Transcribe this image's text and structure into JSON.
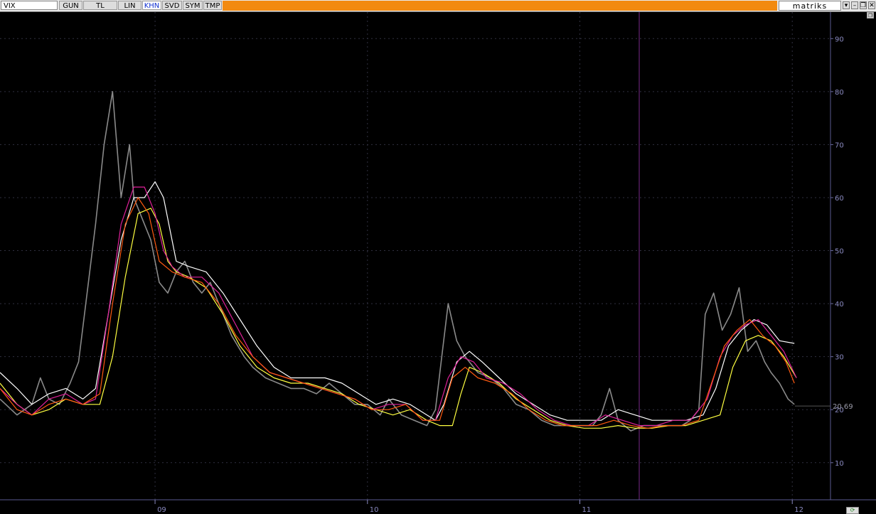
{
  "toolbar": {
    "symbol": "VIX",
    "tabs": [
      {
        "label": "GUN",
        "active": false
      },
      {
        "label": "TL",
        "active": false
      },
      {
        "label": "LIN",
        "active": false
      },
      {
        "label": "KHN",
        "active": true
      },
      {
        "label": "SVD",
        "active": false
      },
      {
        "label": "SYM",
        "active": false
      },
      {
        "label": "TMP",
        "active": false
      }
    ],
    "brand": "matriks",
    "accent_color": "#f28a10"
  },
  "chart_data": {
    "type": "line",
    "ylim": [
      3,
      95
    ],
    "y_ticks": [
      10,
      20,
      30,
      40,
      50,
      60,
      70,
      80,
      90
    ],
    "x_ticks": [
      {
        "label": "09",
        "x": 2009.0
      },
      {
        "label": "10",
        "x": 2010.0
      },
      {
        "label": "11",
        "x": 2011.0
      },
      {
        "label": "12",
        "x": 2012.0
      }
    ],
    "xlim": [
      2008.27,
      2012.18
    ],
    "last_value": "20.69",
    "last_value_num": 20.69,
    "grid": true,
    "series": [
      {
        "key": "price",
        "color": "#8a8a8a",
        "points": [
          [
            2008.27,
            22
          ],
          [
            2008.35,
            19
          ],
          [
            2008.42,
            21
          ],
          [
            2008.46,
            26
          ],
          [
            2008.5,
            22
          ],
          [
            2008.55,
            21
          ],
          [
            2008.6,
            25
          ],
          [
            2008.64,
            29
          ],
          [
            2008.68,
            42
          ],
          [
            2008.72,
            55
          ],
          [
            2008.76,
            70
          ],
          [
            2008.8,
            80
          ],
          [
            2008.84,
            60
          ],
          [
            2008.88,
            70
          ],
          [
            2008.9,
            60
          ],
          [
            2008.94,
            56
          ],
          [
            2008.98,
            52
          ],
          [
            2009.02,
            44
          ],
          [
            2009.06,
            42
          ],
          [
            2009.1,
            46
          ],
          [
            2009.14,
            48
          ],
          [
            2009.18,
            44
          ],
          [
            2009.22,
            42
          ],
          [
            2009.26,
            44
          ],
          [
            2009.32,
            38
          ],
          [
            2009.36,
            34
          ],
          [
            2009.42,
            30
          ],
          [
            2009.46,
            28
          ],
          [
            2009.52,
            26
          ],
          [
            2009.58,
            25
          ],
          [
            2009.64,
            24
          ],
          [
            2009.7,
            24
          ],
          [
            2009.76,
            23
          ],
          [
            2009.82,
            25
          ],
          [
            2009.88,
            23
          ],
          [
            2009.94,
            21
          ],
          [
            2010.0,
            21
          ],
          [
            2010.06,
            19
          ],
          [
            2010.1,
            22
          ],
          [
            2010.16,
            19
          ],
          [
            2010.22,
            18
          ],
          [
            2010.28,
            17
          ],
          [
            2010.32,
            20
          ],
          [
            2010.35,
            30
          ],
          [
            2010.38,
            40
          ],
          [
            2010.42,
            33
          ],
          [
            2010.46,
            30
          ],
          [
            2010.52,
            27
          ],
          [
            2010.58,
            26
          ],
          [
            2010.64,
            24
          ],
          [
            2010.7,
            21
          ],
          [
            2010.76,
            20
          ],
          [
            2010.82,
            18
          ],
          [
            2010.88,
            17
          ],
          [
            2010.94,
            17
          ],
          [
            2011.0,
            17
          ],
          [
            2011.06,
            17
          ],
          [
            2011.1,
            19
          ],
          [
            2011.14,
            24
          ],
          [
            2011.18,
            18
          ],
          [
            2011.24,
            16
          ],
          [
            2011.3,
            17
          ],
          [
            2011.36,
            17
          ],
          [
            2011.42,
            17
          ],
          [
            2011.48,
            17
          ],
          [
            2011.52,
            18
          ],
          [
            2011.56,
            20
          ],
          [
            2011.59,
            38
          ],
          [
            2011.63,
            42
          ],
          [
            2011.67,
            35
          ],
          [
            2011.71,
            38
          ],
          [
            2011.75,
            43
          ],
          [
            2011.79,
            31
          ],
          [
            2011.83,
            33
          ],
          [
            2011.87,
            29
          ],
          [
            2011.9,
            27
          ],
          [
            2011.94,
            25
          ],
          [
            2011.98,
            22
          ],
          [
            2012.01,
            21
          ]
        ]
      },
      {
        "key": "ma_white",
        "color": "#ffffff",
        "points": [
          [
            2008.27,
            27
          ],
          [
            2008.35,
            24
          ],
          [
            2008.42,
            21
          ],
          [
            2008.5,
            23
          ],
          [
            2008.58,
            24
          ],
          [
            2008.66,
            22
          ],
          [
            2008.72,
            24
          ],
          [
            2008.78,
            38
          ],
          [
            2008.84,
            52
          ],
          [
            2008.9,
            60
          ],
          [
            2008.95,
            60
          ],
          [
            2009.0,
            63
          ],
          [
            2009.04,
            60
          ],
          [
            2009.1,
            48
          ],
          [
            2009.16,
            47
          ],
          [
            2009.24,
            46
          ],
          [
            2009.32,
            42
          ],
          [
            2009.4,
            37
          ],
          [
            2009.48,
            32
          ],
          [
            2009.56,
            28
          ],
          [
            2009.64,
            26
          ],
          [
            2009.72,
            26
          ],
          [
            2009.8,
            26
          ],
          [
            2009.88,
            25
          ],
          [
            2009.96,
            23
          ],
          [
            2010.04,
            21
          ],
          [
            2010.12,
            22
          ],
          [
            2010.2,
            21
          ],
          [
            2010.28,
            19
          ],
          [
            2010.32,
            18
          ],
          [
            2010.36,
            21
          ],
          [
            2010.42,
            29
          ],
          [
            2010.48,
            31
          ],
          [
            2010.54,
            29
          ],
          [
            2010.62,
            26
          ],
          [
            2010.7,
            23
          ],
          [
            2010.78,
            21
          ],
          [
            2010.86,
            19
          ],
          [
            2010.94,
            18
          ],
          [
            2011.02,
            18
          ],
          [
            2011.1,
            18
          ],
          [
            2011.18,
            20
          ],
          [
            2011.26,
            19
          ],
          [
            2011.34,
            18
          ],
          [
            2011.42,
            18
          ],
          [
            2011.5,
            18
          ],
          [
            2011.58,
            19
          ],
          [
            2011.64,
            24
          ],
          [
            2011.7,
            32
          ],
          [
            2011.76,
            35
          ],
          [
            2011.82,
            37
          ],
          [
            2011.88,
            36
          ],
          [
            2011.94,
            33
          ],
          [
            2012.01,
            32.5
          ]
        ]
      },
      {
        "key": "ma_yellow",
        "color": "#ffff40",
        "points": [
          [
            2008.27,
            25
          ],
          [
            2008.35,
            21
          ],
          [
            2008.42,
            19
          ],
          [
            2008.5,
            20
          ],
          [
            2008.58,
            22
          ],
          [
            2008.66,
            21
          ],
          [
            2008.74,
            21
          ],
          [
            2008.8,
            30
          ],
          [
            2008.86,
            45
          ],
          [
            2008.92,
            57
          ],
          [
            2008.98,
            58
          ],
          [
            2009.02,
            55
          ],
          [
            2009.06,
            48
          ],
          [
            2009.1,
            46
          ],
          [
            2009.16,
            45
          ],
          [
            2009.24,
            43
          ],
          [
            2009.32,
            38
          ],
          [
            2009.4,
            32
          ],
          [
            2009.48,
            28
          ],
          [
            2009.56,
            26
          ],
          [
            2009.64,
            25
          ],
          [
            2009.72,
            25
          ],
          [
            2009.8,
            24
          ],
          [
            2009.88,
            23
          ],
          [
            2009.96,
            21
          ],
          [
            2010.04,
            20
          ],
          [
            2010.12,
            19
          ],
          [
            2010.2,
            20
          ],
          [
            2010.28,
            18
          ],
          [
            2010.34,
            17
          ],
          [
            2010.4,
            17
          ],
          [
            2010.44,
            23
          ],
          [
            2010.48,
            28
          ],
          [
            2010.54,
            27
          ],
          [
            2010.62,
            25
          ],
          [
            2010.7,
            22
          ],
          [
            2010.78,
            20
          ],
          [
            2010.86,
            18
          ],
          [
            2010.94,
            17
          ],
          [
            2011.02,
            16.5
          ],
          [
            2011.1,
            16.5
          ],
          [
            2011.18,
            17
          ],
          [
            2011.26,
            16.5
          ],
          [
            2011.34,
            16.5
          ],
          [
            2011.42,
            17
          ],
          [
            2011.5,
            17
          ],
          [
            2011.58,
            18
          ],
          [
            2011.66,
            19
          ],
          [
            2011.72,
            28
          ],
          [
            2011.78,
            33
          ],
          [
            2011.84,
            34
          ],
          [
            2011.9,
            33
          ],
          [
            2011.96,
            30
          ],
          [
            2012.02,
            26
          ]
        ]
      },
      {
        "key": "ma_magenta",
        "color": "#e0209a",
        "points": [
          [
            2008.27,
            24
          ],
          [
            2008.35,
            21
          ],
          [
            2008.42,
            19
          ],
          [
            2008.5,
            22
          ],
          [
            2008.58,
            23
          ],
          [
            2008.66,
            21
          ],
          [
            2008.72,
            22
          ],
          [
            2008.78,
            38
          ],
          [
            2008.84,
            55
          ],
          [
            2008.9,
            62
          ],
          [
            2008.95,
            62
          ],
          [
            2009.0,
            57
          ],
          [
            2009.04,
            50
          ],
          [
            2009.08,
            47
          ],
          [
            2009.14,
            45
          ],
          [
            2009.22,
            45
          ],
          [
            2009.3,
            42
          ],
          [
            2009.38,
            36
          ],
          [
            2009.46,
            30
          ],
          [
            2009.54,
            27
          ],
          [
            2009.62,
            26
          ],
          [
            2009.7,
            25
          ],
          [
            2009.78,
            24
          ],
          [
            2009.86,
            23
          ],
          [
            2009.94,
            22
          ],
          [
            2010.02,
            20
          ],
          [
            2010.1,
            21
          ],
          [
            2010.18,
            21
          ],
          [
            2010.26,
            18
          ],
          [
            2010.32,
            18
          ],
          [
            2010.38,
            26
          ],
          [
            2010.44,
            30
          ],
          [
            2010.5,
            29
          ],
          [
            2010.56,
            26
          ],
          [
            2010.64,
            25
          ],
          [
            2010.72,
            23
          ],
          [
            2010.8,
            20
          ],
          [
            2010.88,
            18
          ],
          [
            2010.96,
            17
          ],
          [
            2011.04,
            17
          ],
          [
            2011.12,
            19
          ],
          [
            2011.2,
            18
          ],
          [
            2011.28,
            17
          ],
          [
            2011.36,
            17
          ],
          [
            2011.44,
            18
          ],
          [
            2011.52,
            18
          ],
          [
            2011.6,
            22
          ],
          [
            2011.66,
            30
          ],
          [
            2011.72,
            34
          ],
          [
            2011.78,
            36
          ],
          [
            2011.84,
            37
          ],
          [
            2011.9,
            34
          ],
          [
            2011.96,
            31
          ],
          [
            2012.02,
            26
          ]
        ]
      },
      {
        "key": "ma_orange",
        "color": "#ff5a10",
        "points": [
          [
            2008.27,
            24
          ],
          [
            2008.35,
            20
          ],
          [
            2008.42,
            19
          ],
          [
            2008.5,
            21
          ],
          [
            2008.58,
            22
          ],
          [
            2008.66,
            21
          ],
          [
            2008.74,
            23
          ],
          [
            2008.8,
            40
          ],
          [
            2008.86,
            55
          ],
          [
            2008.92,
            60
          ],
          [
            2008.97,
            57
          ],
          [
            2009.02,
            48
          ],
          [
            2009.08,
            46
          ],
          [
            2009.14,
            45
          ],
          [
            2009.22,
            44
          ],
          [
            2009.3,
            40
          ],
          [
            2009.38,
            34
          ],
          [
            2009.46,
            30
          ],
          [
            2009.54,
            27
          ],
          [
            2009.62,
            26
          ],
          [
            2009.7,
            25
          ],
          [
            2009.78,
            24
          ],
          [
            2009.86,
            23
          ],
          [
            2009.94,
            22
          ],
          [
            2010.02,
            20
          ],
          [
            2010.1,
            20
          ],
          [
            2010.18,
            21
          ],
          [
            2010.26,
            18
          ],
          [
            2010.34,
            18
          ],
          [
            2010.4,
            26
          ],
          [
            2010.46,
            28
          ],
          [
            2010.52,
            26
          ],
          [
            2010.6,
            25
          ],
          [
            2010.68,
            23
          ],
          [
            2010.76,
            20
          ],
          [
            2010.84,
            18
          ],
          [
            2010.92,
            17
          ],
          [
            2011.0,
            17
          ],
          [
            2011.08,
            17
          ],
          [
            2011.16,
            18
          ],
          [
            2011.24,
            17
          ],
          [
            2011.32,
            16.5
          ],
          [
            2011.4,
            17
          ],
          [
            2011.48,
            17
          ],
          [
            2011.56,
            18
          ],
          [
            2011.62,
            25
          ],
          [
            2011.68,
            32
          ],
          [
            2011.74,
            35
          ],
          [
            2011.8,
            37
          ],
          [
            2011.86,
            34
          ],
          [
            2011.92,
            32
          ],
          [
            2011.97,
            29
          ],
          [
            2012.01,
            25
          ]
        ]
      }
    ]
  }
}
